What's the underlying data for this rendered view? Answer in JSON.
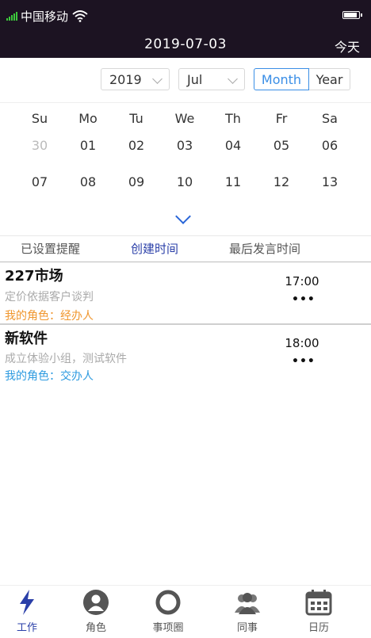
{
  "status_bar": {
    "carrier": "中国移动",
    "date": "2019-07-03",
    "today_label": "今天"
  },
  "selectors": {
    "year": "2019",
    "month": "Jul",
    "view_month": "Month",
    "view_year": "Year"
  },
  "calendar": {
    "weekdays": [
      "Su",
      "Mo",
      "Tu",
      "We",
      "Th",
      "Fr",
      "Sa"
    ],
    "week1": [
      "30",
      "01",
      "02",
      "03",
      "04",
      "05",
      "06"
    ],
    "week2": [
      "07",
      "08",
      "09",
      "10",
      "11",
      "12",
      "13"
    ]
  },
  "sort_tabs": [
    "已设置提醒",
    "创建时间",
    "最后发言时间"
  ],
  "items": [
    {
      "title": "227市场",
      "desc": "定价依据客户谈判",
      "role": "我的角色：经办人",
      "time": "17:00",
      "more": "•••"
    },
    {
      "title": "新软件",
      "desc": "成立体验小组，测试软件",
      "role": "我的角色：交办人",
      "time": "18:00",
      "more": "•••"
    }
  ],
  "colors": {
    "header_bg": "#1c1322",
    "accent": "#3a8ee6",
    "active_tab": "#2a3fa8",
    "role_orange": "#f0962d",
    "role_blue": "#2e9be0"
  },
  "tabbar": [
    {
      "label": "工作",
      "icon": "lightning-icon"
    },
    {
      "label": "角色",
      "icon": "person-icon"
    },
    {
      "label": "事项圈",
      "icon": "ring-icon"
    },
    {
      "label": "同事",
      "icon": "colleagues-icon"
    },
    {
      "label": "日历",
      "icon": "calendar-icon"
    }
  ]
}
